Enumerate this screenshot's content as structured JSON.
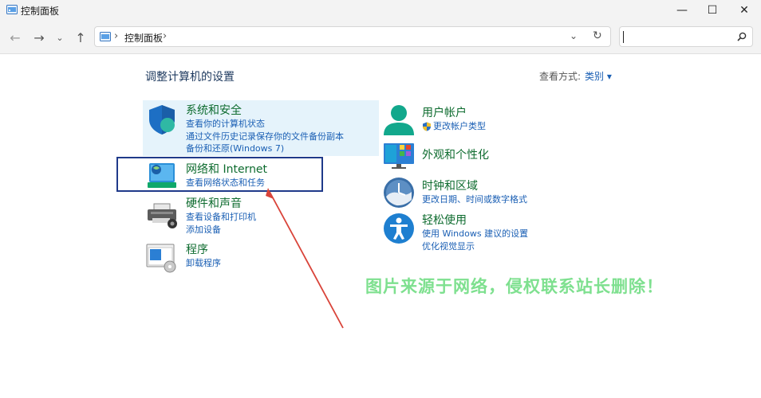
{
  "window": {
    "title": "控制面板",
    "minimize_glyph": "—",
    "maximize_glyph": "☐",
    "close_glyph": "✕"
  },
  "nav": {
    "back_glyph": "←",
    "forward_glyph": "→",
    "recent_glyph": "⌄",
    "up_glyph": "↑",
    "address_path": "控制面板",
    "address_sep": "›",
    "dropdown_glyph": "⌄",
    "refresh_glyph": "↻",
    "search_value": ""
  },
  "header": {
    "title": "调整计算机的设置",
    "view_by_label": "查看方式:",
    "view_by_value": "类别 ▾"
  },
  "categories_left": [
    {
      "title": "系统和安全",
      "links": [
        "查看你的计算机状态",
        "通过文件历史记录保存你的文件备份副本",
        "备份和还原(Windows 7)"
      ]
    },
    {
      "title": "网络和 Internet",
      "links": [
        "查看网络状态和任务"
      ]
    },
    {
      "title": "硬件和声音",
      "links": [
        "查看设备和打印机",
        "添加设备"
      ]
    },
    {
      "title": "程序",
      "links": [
        "卸载程序"
      ]
    }
  ],
  "categories_right": [
    {
      "title": "用户帐户",
      "links": [
        "更改帐户类型"
      ]
    },
    {
      "title": "外观和个性化",
      "links": []
    },
    {
      "title": "时钟和区域",
      "links": [
        "更改日期、时间或数字格式"
      ]
    },
    {
      "title": "轻松使用",
      "links": [
        "使用 Windows 建议的设置",
        "优化视觉显示"
      ]
    }
  ],
  "watermark": "图片来源于网络，侵权联系站长删除！",
  "colors": {
    "accent": "#1a5fb4",
    "category_title": "#0d6b2e",
    "highlight": "#e5f3fb",
    "annotation_box": "#1f3a8a",
    "annotation_arrow": "#d9443a",
    "watermark": "#7ee08f"
  },
  "icons": [
    "control-panel-icon",
    "shield-icon",
    "network-icon",
    "printer-icon",
    "programs-icon",
    "user-icon",
    "uac-shield-icon",
    "appearance-icon",
    "clock-icon",
    "accessibility-icon",
    "search-icon"
  ]
}
